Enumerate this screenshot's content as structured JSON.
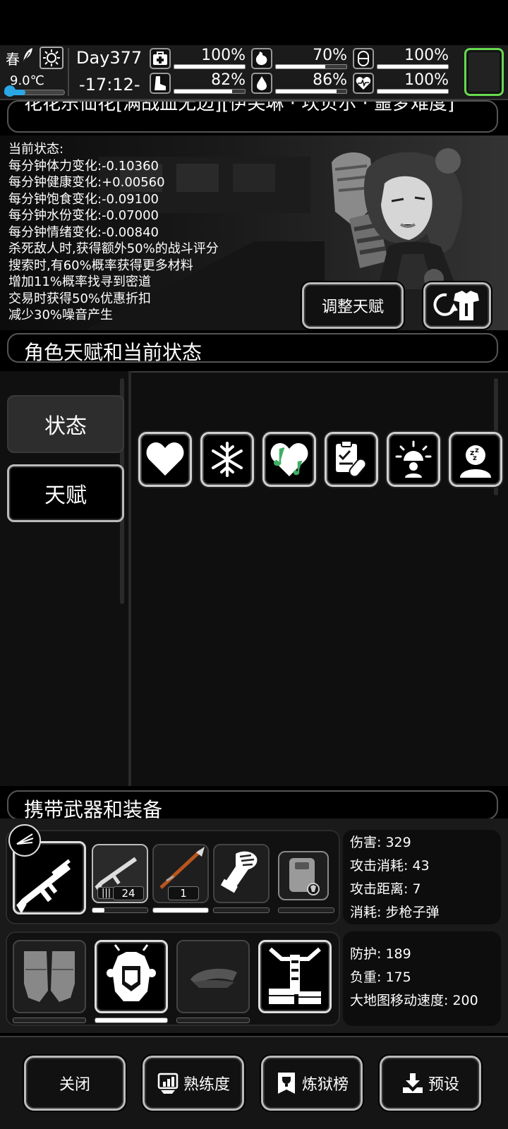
{
  "top_bar": {
    "season": "春",
    "temperature": "9.0℃",
    "temperature_level": 0.35,
    "day": "Day377",
    "time": "-17:12-",
    "stats": [
      {
        "name": "medical",
        "value": "100%",
        "level": 1.0
      },
      {
        "name": "stomach",
        "value": "70%",
        "level": 0.7
      },
      {
        "name": "mood",
        "value": "100%",
        "level": 1.0
      },
      {
        "name": "stamina",
        "value": "82%",
        "level": 0.82
      },
      {
        "name": "water",
        "value": "86%",
        "level": 0.86
      },
      {
        "name": "health",
        "value": "100%",
        "level": 1.0
      }
    ],
    "accent_color": "#66d94f"
  },
  "character": {
    "title": "花花乐仙花[满战血无边][伊芙琳 · 坎贝尔 · 噩梦难度]",
    "status_heading": "当前状态:",
    "status_lines": [
      "每分钟体力变化:-0.10360",
      "每分钟健康变化:+0.00560",
      "每分钟饱食变化:-0.09100",
      "每分钟水份变化:-0.07000",
      "每分钟情绪变化:-0.00840",
      "杀死敌人时,获得额外50%的战斗评分",
      "搜索时,有60%概率获得更多材料",
      "增加11%概率找寻到密道",
      "交易时获得50%优惠折扣",
      "减少30%噪音产生"
    ],
    "adjust_button": "调整天赋"
  },
  "talent_section": {
    "header": "角色天赋和当前状态",
    "tabs": [
      "状态",
      "天赋"
    ],
    "status_icons": [
      "heart-icon",
      "snowflake-icon",
      "music-heart-icon",
      "medicine-icon",
      "alarm-icon",
      "sleep-icon"
    ]
  },
  "equipment_section": {
    "header": "携带武器和装备",
    "weapon_counts": [
      "24",
      "1"
    ],
    "weapon_stats": {
      "damage": "伤害: 329",
      "attack_cost": "攻击消耗: 43",
      "attack_range": "攻击距离: 7",
      "consume": "消耗: 步枪子弹"
    },
    "armor_stats": {
      "defense": "防护: 189",
      "load": "负重: 175",
      "map_speed": "大地图移动速度: 200"
    }
  },
  "bottom_buttons": {
    "close": "关闭",
    "proficiency": "熟练度",
    "ranking": "炼狱榜",
    "preset": "预设"
  }
}
